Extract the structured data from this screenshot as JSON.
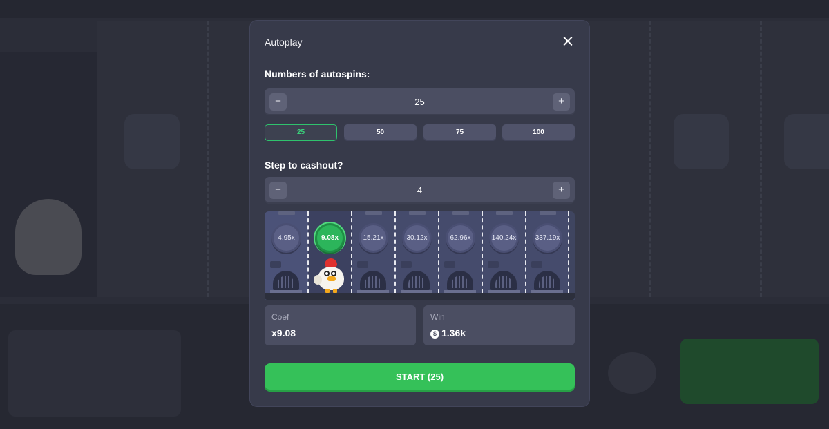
{
  "modal": {
    "title": "Autoplay",
    "autospins_label": "Numbers of autospins:",
    "autospins_value": "25",
    "minus_symbol": "−",
    "plus_symbol": "+",
    "presets": [
      "25",
      "50",
      "75",
      "100"
    ],
    "active_preset": "25",
    "cashout_label": "Step to cashout?",
    "cashout_value": "4",
    "lanes": [
      {
        "coef": "4.95x",
        "state": "normal"
      },
      {
        "coef": "9.08x",
        "state": "hit"
      },
      {
        "coef": "15.21x",
        "state": "normal"
      },
      {
        "coef": "30.12x",
        "state": "normal"
      },
      {
        "coef": "62.96x",
        "state": "normal"
      },
      {
        "coef": "140.24x",
        "state": "normal"
      },
      {
        "coef": "337.19x",
        "state": "normal"
      }
    ],
    "coef_label": "Coef",
    "coef_value": "x9.08",
    "win_label": "Win",
    "win_currency": "$",
    "win_value": "1.36k",
    "start_label": "START (25)"
  },
  "icons": {
    "close": "close-icon",
    "currency": "dollar-icon",
    "chicken": "chicken-icon",
    "manhole": "manhole-icon"
  },
  "colors": {
    "accent_green": "#35c159",
    "modal_bg": "#373a4a",
    "hit_coef": "#2cb55b"
  }
}
